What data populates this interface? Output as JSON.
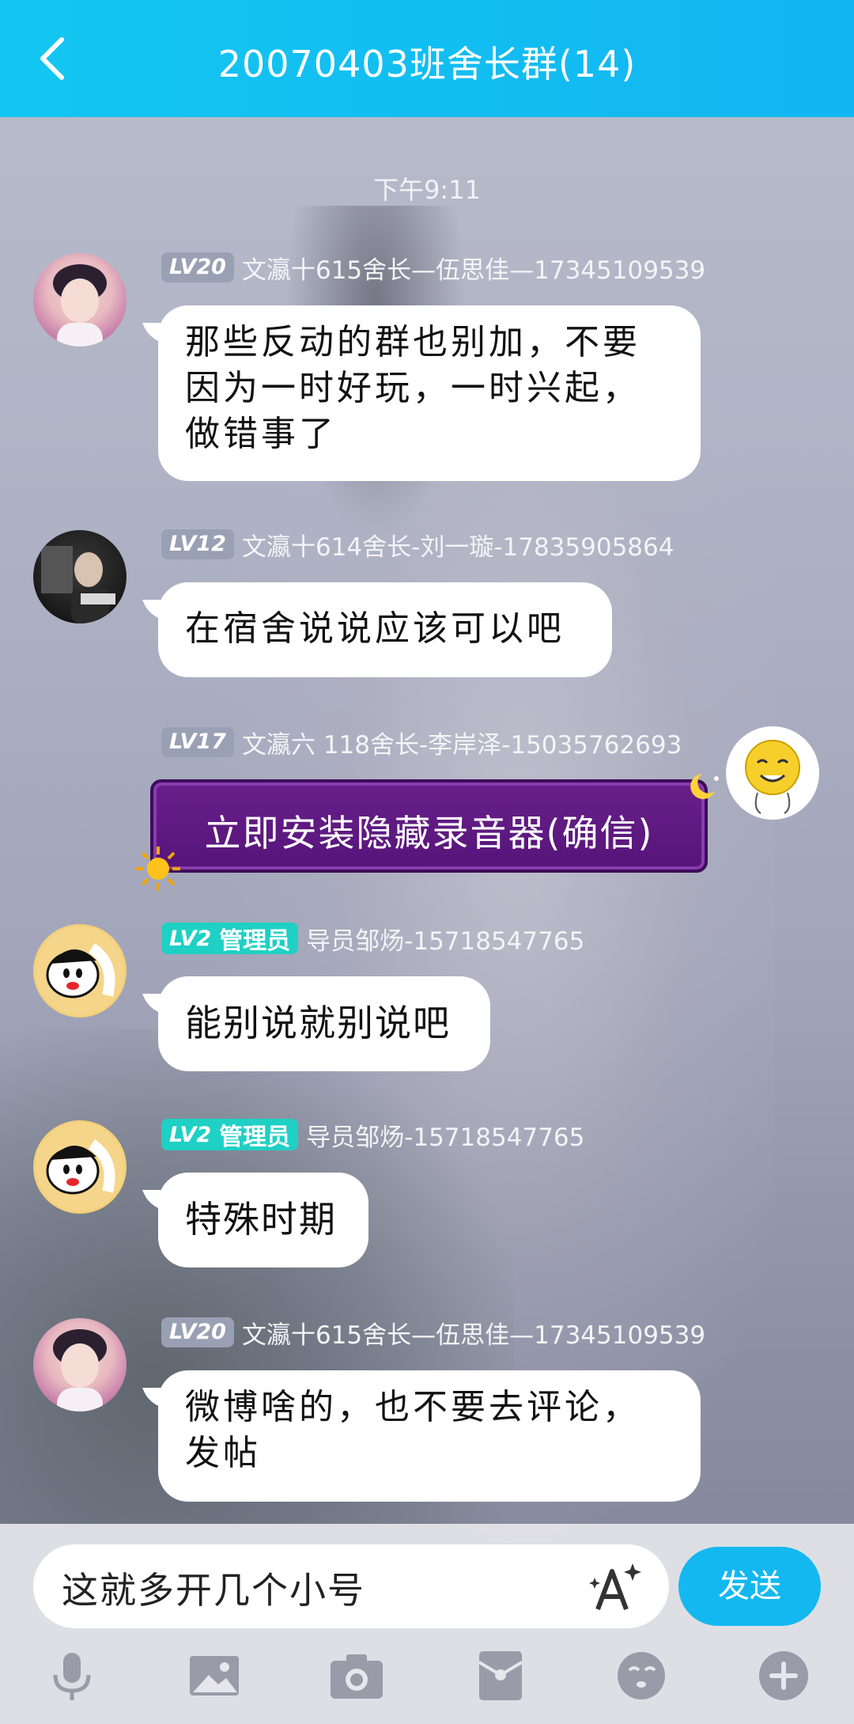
{
  "header": {
    "title": "20070403班舍长群(14)"
  },
  "timestamp": "下午9:11",
  "messages": [
    {
      "level": "LV20",
      "sender": "文瀛十615舍长—伍思佳—17345109539",
      "lines": [
        "那些反动的群也别加，不要",
        "因为一时好玩，一时兴起，",
        "做错事了"
      ]
    },
    {
      "level": "LV12",
      "sender": "文瀛十614舍长-刘一璇-17835905864",
      "lines": [
        "在宿舍说说应该可以吧"
      ]
    },
    {
      "level": "LV17",
      "sender": "文瀛六 118舍长-李岸泽-15035762693",
      "text": "立即安装隐藏录音器(确信)"
    },
    {
      "level": "LV2",
      "role": "管理员",
      "sender": "导员邹炀-15718547765",
      "text": "能别说就别说吧"
    },
    {
      "level": "LV2",
      "role": "管理员",
      "sender": "导员邹炀-15718547765",
      "text": "特殊时期"
    },
    {
      "level": "LV20",
      "sender": "文瀛十615舍长—伍思佳—17345109539",
      "lines": [
        "微博啥的，也不要去评论，",
        "发帖"
      ]
    }
  ],
  "input": {
    "value": "这就多开几个小号",
    "send_label": "发送"
  },
  "toolbar_icons": [
    "microphone-icon",
    "image-icon",
    "camera-icon",
    "red-packet-icon",
    "emoji-icon",
    "plus-icon"
  ],
  "colors": {
    "header": "#13c6f1",
    "send": "#13b8f0",
    "admin_badge": "#1fd0c4",
    "level_badge": "#9aa0b3",
    "purple_bubble": "#6a1f8a"
  }
}
